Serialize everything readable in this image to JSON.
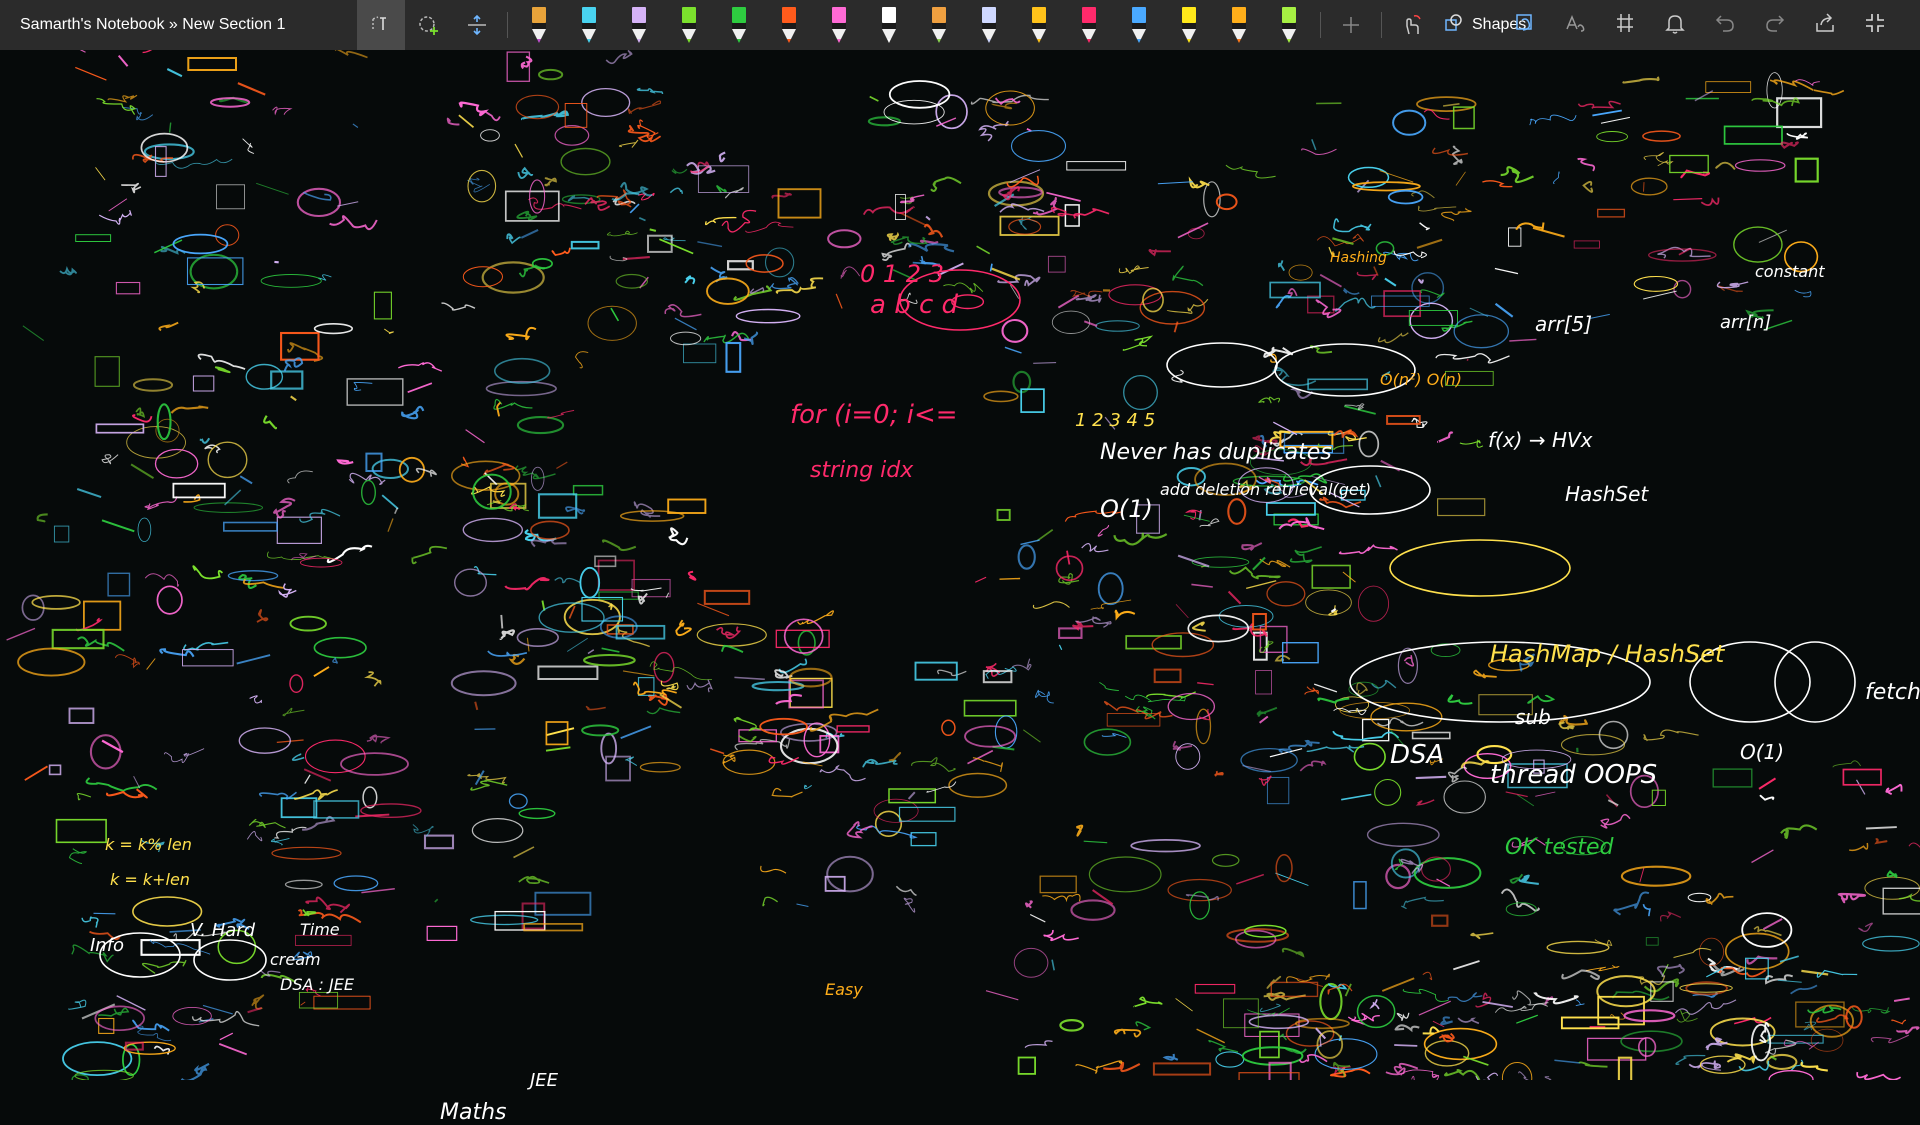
{
  "window": {
    "title": "Samarth's Notebook » New Section 1"
  },
  "toolbar": {
    "pens": [
      {
        "name": "pen-orange-purple",
        "color": "#e8a33a",
        "tip": "#c04fcf"
      },
      {
        "name": "pen-cyan",
        "color": "#49d3f0",
        "tip": "#49d3f0"
      },
      {
        "name": "pen-lavender",
        "color": "#d6b3f7",
        "tip": "#d6b3f7"
      },
      {
        "name": "pen-green",
        "color": "#7be02d",
        "tip": "#7be02d"
      },
      {
        "name": "highlighter-green",
        "color": "#2ecc40",
        "tip": "#2ecc40"
      },
      {
        "name": "pen-orange-red",
        "color": "#ff5b1c",
        "tip": "#ff5b1c"
      },
      {
        "name": "pen-pink",
        "color": "#ff6ad5",
        "tip": "#ff6ad5"
      },
      {
        "name": "pen-white",
        "color": "#ffffff",
        "tip": "#ffffff"
      },
      {
        "name": "pen-rainbow",
        "color": "#f0a040",
        "tip": "#8bd450"
      },
      {
        "name": "pen-light-blue",
        "color": "#cfd8ff",
        "tip": "#cfd8ff"
      },
      {
        "name": "pen-yellow-orange",
        "color": "#ffc21a",
        "tip": "#ffc21a"
      },
      {
        "name": "pen-crimson",
        "color": "#ff2a6b",
        "tip": "#ff2a6b"
      },
      {
        "name": "pen-sky-blue",
        "color": "#4aa9ff",
        "tip": "#4aa9ff"
      },
      {
        "name": "pen-yellow",
        "color": "#ffe81a",
        "tip": "#ffe81a"
      },
      {
        "name": "pen-amber",
        "color": "#ffae1a",
        "tip": "#ff7a1a"
      },
      {
        "name": "pen-lime",
        "color": "#a6f043",
        "tip": "#a6f043"
      }
    ],
    "shapes_label": "Shapes"
  },
  "ink": {
    "notes": [
      {
        "text": "DSA",
        "color": "#ffffff"
      },
      {
        "text": "HashMap / HashSet",
        "color": "#ffe14d"
      },
      {
        "text": "thread OOPS",
        "color": "#ffffff"
      },
      {
        "text": "Never has duplicates",
        "color": "#ffffff"
      },
      {
        "text": "HashSet",
        "color": "#ffffff"
      },
      {
        "text": "f(x) → HVx",
        "color": "#ffffff"
      },
      {
        "text": "arr[5]",
        "color": "#ffffff"
      },
      {
        "text": "arr[n]",
        "color": "#ffffff"
      },
      {
        "text": "constant",
        "color": "#ffffff"
      },
      {
        "text": "O(1)",
        "color": "#ffffff"
      },
      {
        "text": "add deletion retrieval(get)",
        "color": "#ffffff"
      },
      {
        "text": "1 2 3 4 5",
        "color": "#ffe14d"
      },
      {
        "text": "Maths",
        "color": "#ffffff"
      },
      {
        "text": "JEE",
        "color": "#ffffff"
      },
      {
        "text": "Info",
        "color": "#ffffff"
      },
      {
        "text": "V. Hard",
        "color": "#ffffff"
      },
      {
        "text": "Time",
        "color": "#ffffff"
      },
      {
        "text": "cream",
        "color": "#ffffff"
      },
      {
        "text": "DSA : JEE",
        "color": "#ffffff"
      },
      {
        "text": "Easy",
        "color": "#ffae1a"
      },
      {
        "text": "OK tested",
        "color": "#2ecc40"
      },
      {
        "text": "string idx",
        "color": "#ff2a6b"
      },
      {
        "text": "a b c d",
        "color": "#ff2a6b"
      },
      {
        "text": "0 1 2 3",
        "color": "#ff2a6b"
      },
      {
        "text": "for (i=0; i<=",
        "color": "#ff2a6b"
      },
      {
        "text": "Hashing",
        "color": "#ffae1a"
      },
      {
        "text": "k = k% len",
        "color": "#ffe14d"
      },
      {
        "text": "k = k+len",
        "color": "#ffe14d"
      },
      {
        "text": "O(n²) O(n)",
        "color": "#ffae1a"
      },
      {
        "text": "sub",
        "color": "#ffffff"
      },
      {
        "text": "O(1)",
        "color": "#ffffff"
      },
      {
        "text": "fetch",
        "color": "#ffffff"
      }
    ]
  }
}
